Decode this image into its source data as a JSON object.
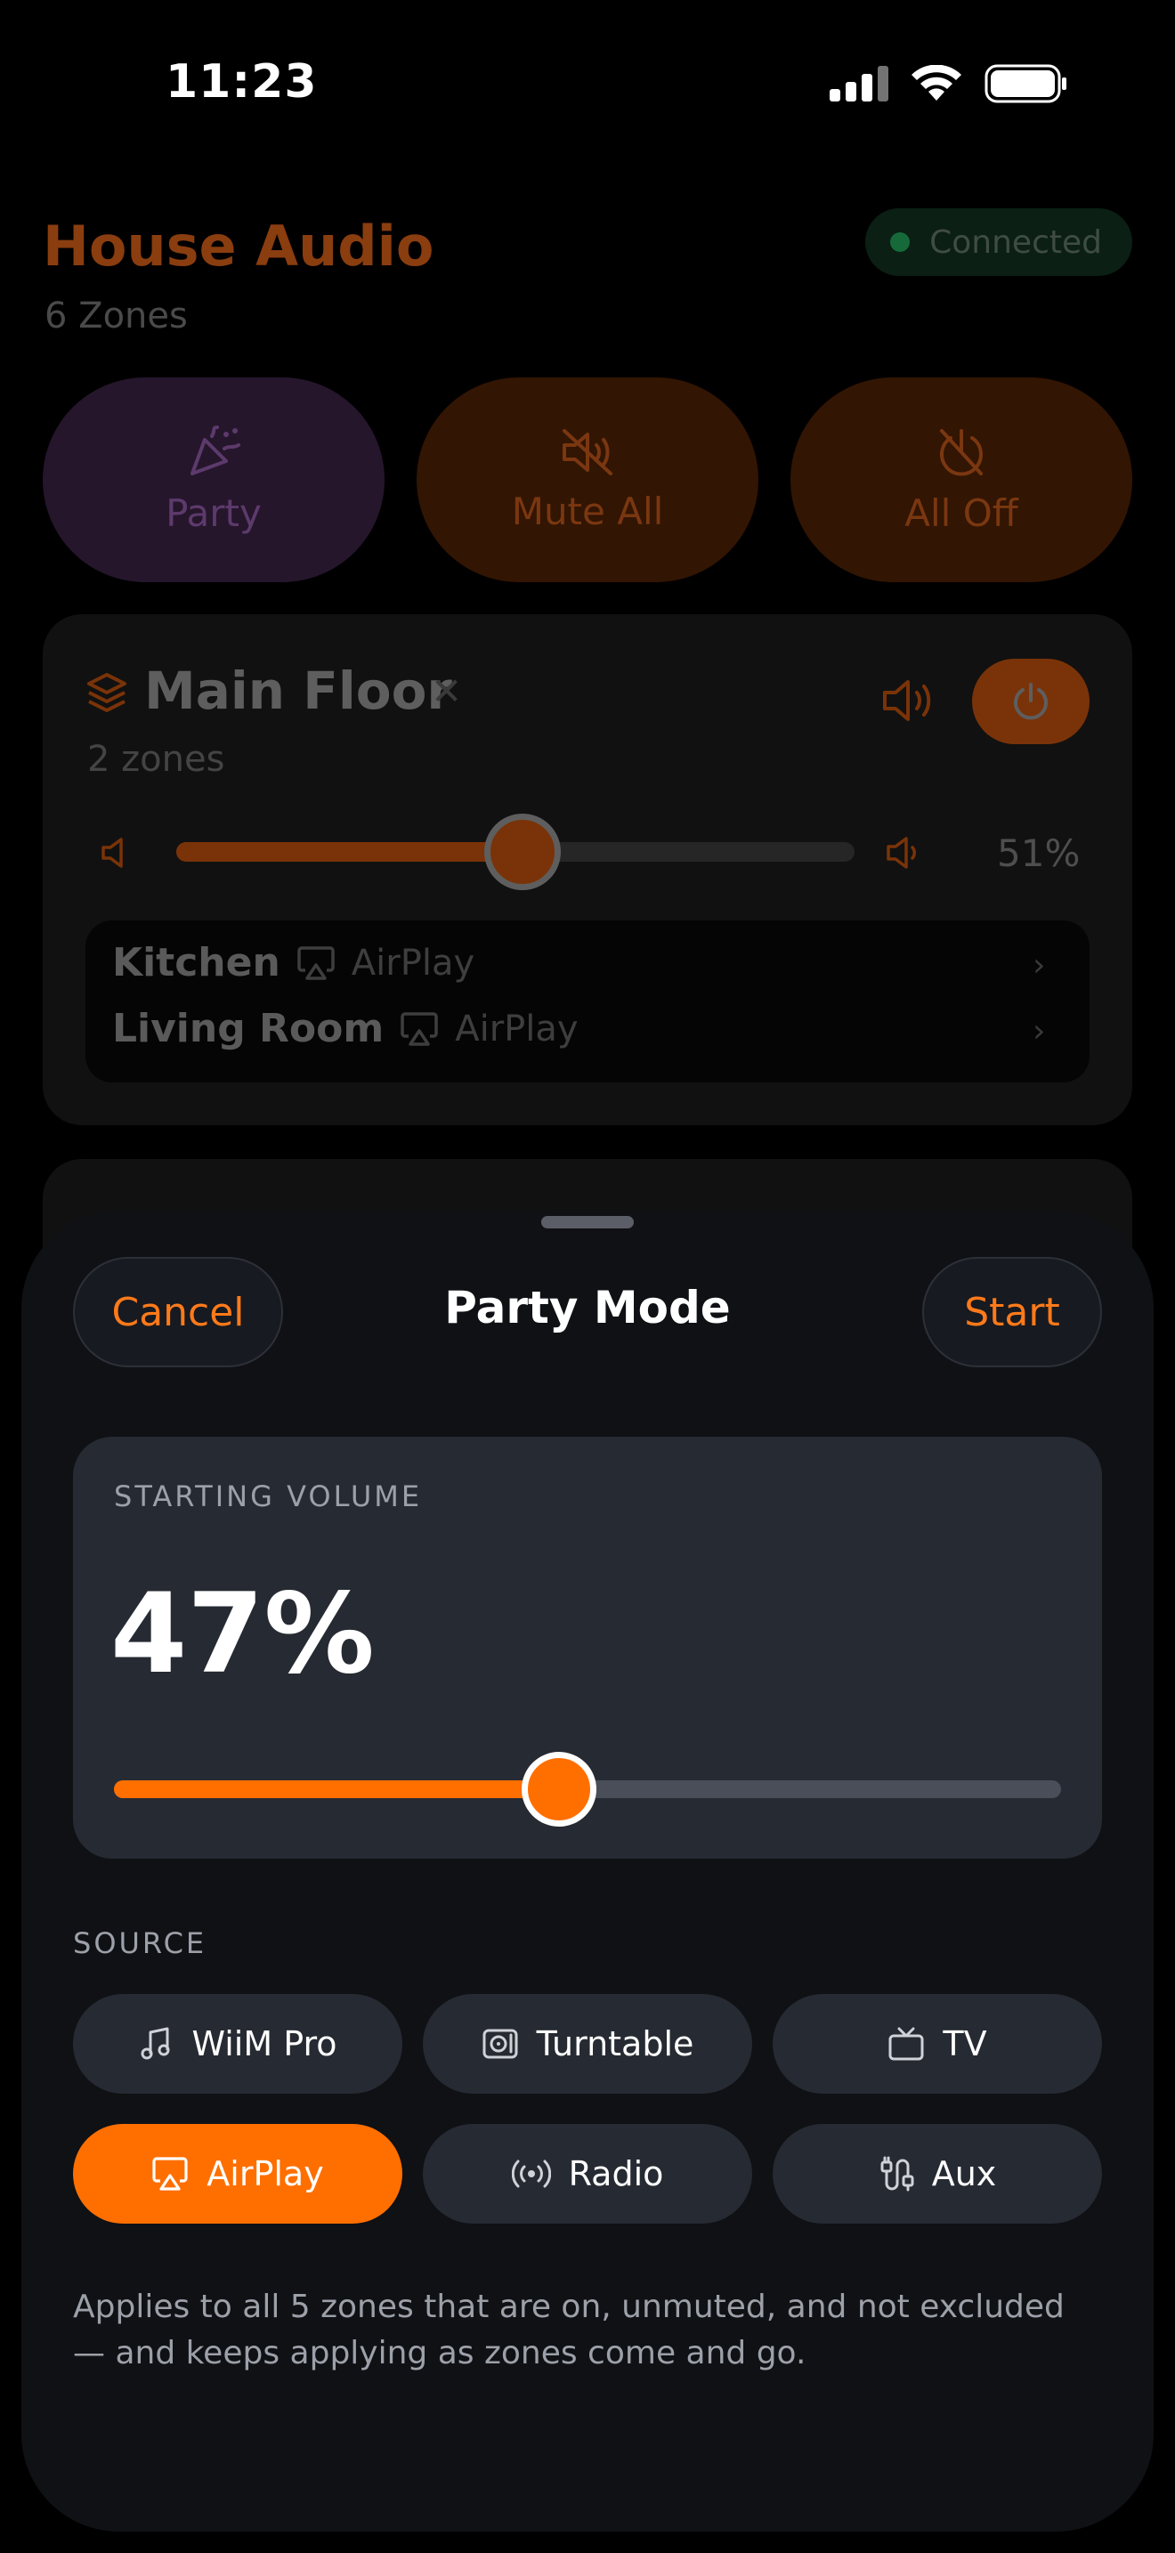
{
  "status_bar": {
    "time": "11:23"
  },
  "header": {
    "title": "House Audio",
    "subtitle": "6 Zones",
    "connection": "Connected"
  },
  "quick_actions": [
    {
      "label": "Party",
      "icon": "party-popper-icon"
    },
    {
      "label": "Mute All",
      "icon": "speaker-muted-icon"
    },
    {
      "label": "All Off",
      "icon": "power-off-icon"
    }
  ],
  "zone_group": {
    "name": "Main Floor",
    "zones_count": "2 zones",
    "volume": 0.51,
    "volume_text": "51%",
    "rooms": [
      {
        "name": "Kitchen",
        "source": "AirPlay"
      },
      {
        "name": "Living Room",
        "source": "AirPlay"
      }
    ]
  },
  "sheet": {
    "title": "Party Mode",
    "cancel_label": "Cancel",
    "start_label": "Start",
    "volume_label": "STARTING VOLUME",
    "volume_value": 0.47,
    "volume_text": "47%",
    "source_label": "SOURCE",
    "sources": [
      {
        "label": "WiiM Pro",
        "icon": "music-note-icon",
        "selected": false
      },
      {
        "label": "Turntable",
        "icon": "turntable-icon",
        "selected": false
      },
      {
        "label": "TV",
        "icon": "tv-icon",
        "selected": false
      },
      {
        "label": "AirPlay",
        "icon": "airplay-icon",
        "selected": true
      },
      {
        "label": "Radio",
        "icon": "radio-icon",
        "selected": false
      },
      {
        "label": "Aux",
        "icon": "aux-cable-icon",
        "selected": false
      }
    ],
    "note": "Applies to all 5 zones that are on, unmuted, and not excluded — and keeps applying as zones come and go."
  },
  "colors": {
    "accent": "#ff6f00",
    "sheet_bg": "#0f1115",
    "card_bg": "#262a32",
    "muted_text": "#9ca0a8"
  }
}
